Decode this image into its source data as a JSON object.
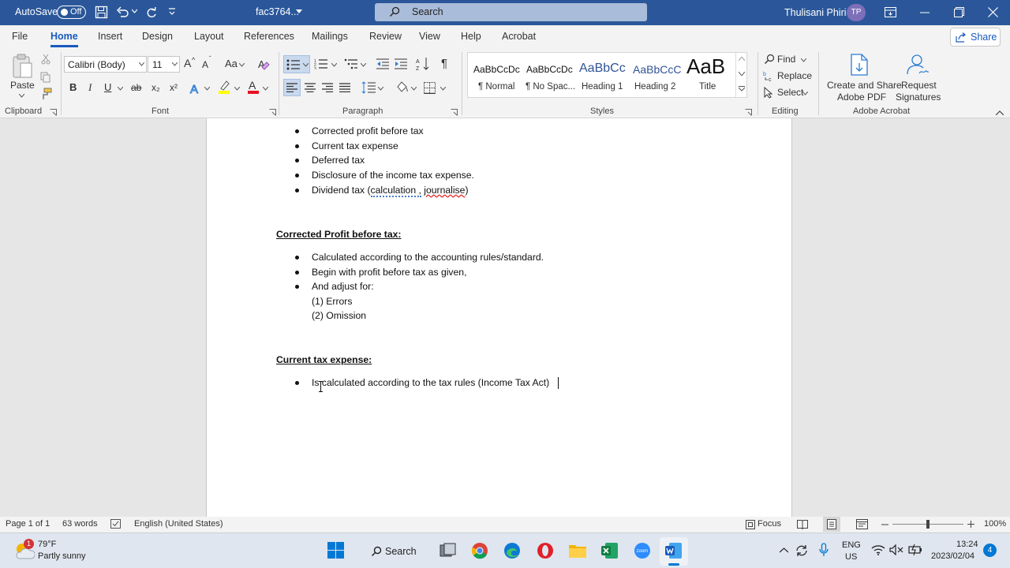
{
  "titlebar": {
    "autosave_label": "AutoSave",
    "autosave_state": "Off",
    "filename": "fac3764...",
    "search_placeholder": "Search",
    "user_name": "Thulisani Phiri",
    "user_initials": "TP"
  },
  "menu": {
    "file": "File",
    "home": "Home",
    "insert": "Insert",
    "design": "Design",
    "layout": "Layout",
    "references": "References",
    "mailings": "Mailings",
    "review": "Review",
    "view": "View",
    "help": "Help",
    "acrobat": "Acrobat",
    "share": "Share"
  },
  "ribbon": {
    "paste": "Paste",
    "font_name": "Calibri (Body)",
    "font_size": "11",
    "bold": "B",
    "italic": "I",
    "underline": "U",
    "strike": "ab",
    "subscript": "x₂",
    "superscript": "x²",
    "grow_font": "A",
    "shrink_font": "A",
    "change_case": "Aa",
    "styles": [
      {
        "preview": "AaBbCcDc",
        "name": "¶ Normal"
      },
      {
        "preview": "AaBbCcDc",
        "name": "¶ No Spac..."
      },
      {
        "preview": "AaBbCc",
        "name": "Heading 1"
      },
      {
        "preview": "AaBbCcC",
        "name": "Heading 2"
      },
      {
        "preview": "AaB",
        "name": "Title"
      }
    ],
    "find": "Find",
    "replace": "Replace",
    "select": "Select",
    "create_share": "Create and Share",
    "adobe_pdf": "Adobe PDF",
    "request": "Request",
    "signatures": "Signatures",
    "groups": {
      "clipboard": "Clipboard",
      "font": "Font",
      "paragraph": "Paragraph",
      "styles": "Styles",
      "editing": "Editing",
      "adobe": "Adobe Acrobat"
    }
  },
  "document": {
    "top_bullets": [
      "Corrected profit before tax",
      "Current tax expense",
      "Deferred tax",
      "Disclosure of the income tax expense."
    ],
    "dividend_prefix": "Dividend tax (",
    "dividend_calc": "calculation ,",
    "dividend_journal": "journalise",
    "dividend_suffix": ")",
    "heading1": "Corrected Profit before tax:",
    "cp_bullets": [
      "Calculated according to the accounting rules/standard.",
      "Begin with profit before tax as given,",
      "And adjust for:"
    ],
    "adjust_items": [
      "(1)  Errors",
      "(2)  Omission"
    ],
    "heading2": "Current tax expense:",
    "ct_bullet": "Is calculated according to the tax rules (Income Tax Act)"
  },
  "status": {
    "page": "Page 1 of 1",
    "words": "63 words",
    "language": "English (United States)",
    "focus": "Focus",
    "zoom": "100%"
  },
  "taskbar": {
    "temp": "79°F",
    "weather": "Partly sunny",
    "weather_badge": "1",
    "search": "Search",
    "lang1": "ENG",
    "lang2": "US",
    "time": "13:24",
    "date": "2023/02/04",
    "notifications": "4"
  },
  "colors": {
    "word_blue": "#2b579a",
    "accent": "#185abd"
  }
}
